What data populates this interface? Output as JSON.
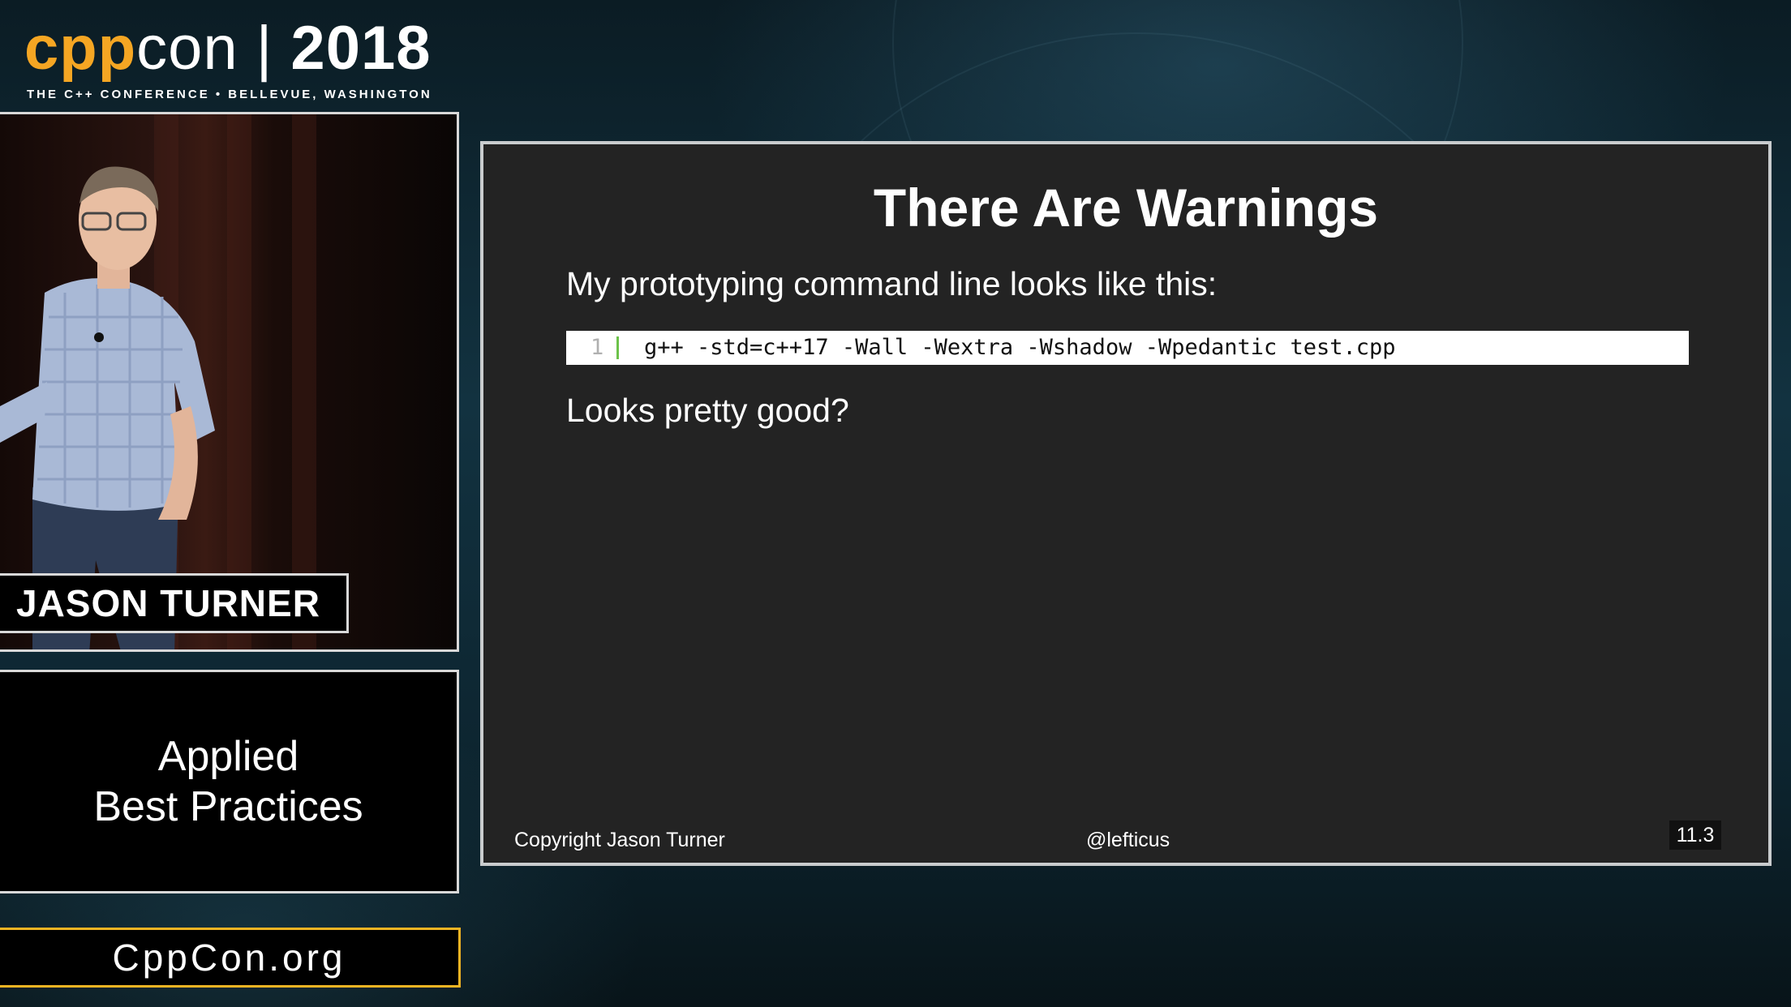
{
  "logo": {
    "cpp": "cpp",
    "con": "con",
    "separator": "|",
    "year": "2018",
    "subtitle": "THE C++ CONFERENCE • BELLEVUE, WASHINGTON"
  },
  "speaker": {
    "name": "JASON TURNER"
  },
  "talk": {
    "title_line1": "Applied",
    "title_line2": "Best Practices"
  },
  "website": "CppCon.org",
  "slide": {
    "title": "There Are Warnings",
    "intro": "My prototyping command line looks like this:",
    "code": {
      "line_number": "1",
      "text": "g++ -std=c++17 -Wall -Wextra -Wshadow -Wpedantic test.cpp"
    },
    "question": "Looks pretty good?",
    "footer_left": "Copyright Jason Turner",
    "footer_center": "@lefticus",
    "slide_number": "11.3"
  },
  "colors": {
    "brand_orange": "#f5a623",
    "site_border": "#f2b423",
    "slide_bg": "#232323",
    "code_bar": "#6cc24a"
  }
}
